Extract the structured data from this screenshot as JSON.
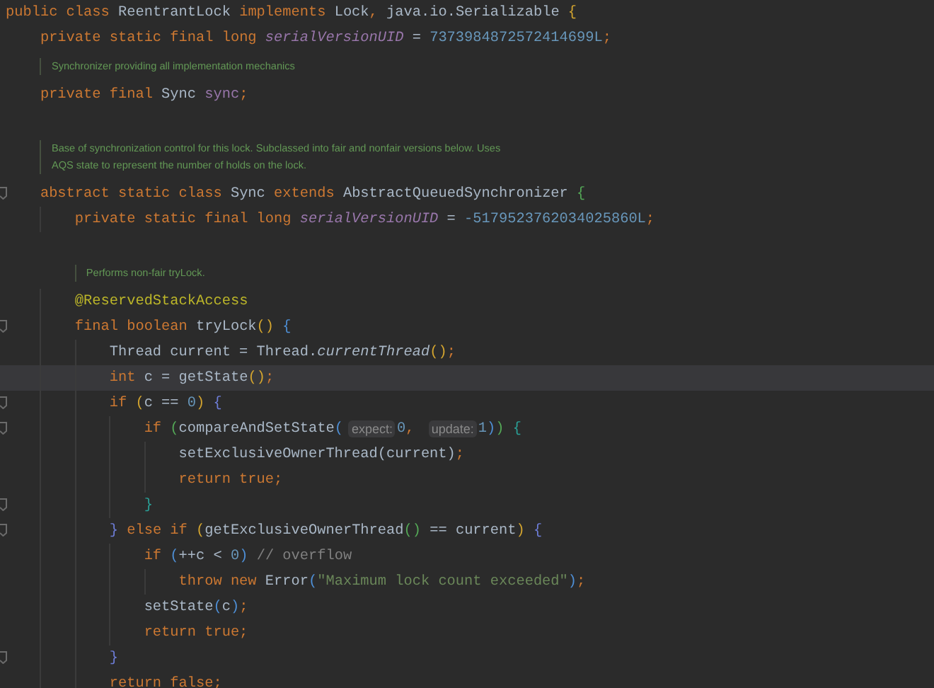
{
  "editor": {
    "lines": [
      {
        "kind": "code",
        "fold": false,
        "current": false,
        "tokens": [
          {
            "text": "public class ",
            "kind": "kw"
          },
          {
            "text": "ReentrantLock ",
            "kind": "plain"
          },
          {
            "text": "implements ",
            "kind": "kw"
          },
          {
            "text": "Lock",
            "kind": "plain"
          },
          {
            "text": ", ",
            "kind": "kw"
          },
          {
            "text": "java.io.Serializable ",
            "kind": "plain"
          },
          {
            "text": "{",
            "kind": "b1"
          }
        ]
      },
      {
        "kind": "code",
        "fold": false,
        "current": false,
        "tokens": [
          {
            "text": "    private static final long ",
            "kind": "kw"
          },
          {
            "text": "serialVersionUID",
            "kind": "sfield"
          },
          {
            "text": " = ",
            "kind": "plain"
          },
          {
            "text": "7373984872572414699L",
            "kind": "num"
          },
          {
            "text": ";",
            "kind": "kw"
          }
        ]
      },
      {
        "kind": "doc",
        "text": [
          "Synchronizer providing all implementation mechanics"
        ]
      },
      {
        "kind": "code",
        "fold": false,
        "current": false,
        "tokens": [
          {
            "text": "    private final ",
            "kind": "kw"
          },
          {
            "text": "Sync ",
            "kind": "plain"
          },
          {
            "text": "sync",
            "kind": "field"
          },
          {
            "text": ";",
            "kind": "kw"
          }
        ]
      },
      {
        "kind": "blank"
      },
      {
        "kind": "doc",
        "text": [
          "Base of synchronization control for this lock. Subclassed into fair and nonfair versions below. Uses",
          "AQS state to represent the number of holds on the lock."
        ]
      },
      {
        "kind": "code",
        "fold": true,
        "current": false,
        "tokens": [
          {
            "text": "    abstract static class ",
            "kind": "kw"
          },
          {
            "text": "Sync ",
            "kind": "plain"
          },
          {
            "text": "extends ",
            "kind": "kw"
          },
          {
            "text": "AbstractQueuedSynchronizer ",
            "kind": "plain"
          },
          {
            "text": "{",
            "kind": "b2"
          }
        ]
      },
      {
        "kind": "code",
        "fold": false,
        "current": false,
        "tokens": [
          {
            "text": "        private static final long ",
            "kind": "kw"
          },
          {
            "text": "serialVersionUID",
            "kind": "sfield"
          },
          {
            "text": " = ",
            "kind": "plain"
          },
          {
            "text": "-5179523762034025860L",
            "kind": "num"
          },
          {
            "text": ";",
            "kind": "kw"
          }
        ]
      },
      {
        "kind": "blank"
      },
      {
        "kind": "doc",
        "text": [
          "Performs non-fair tryLock."
        ]
      },
      {
        "kind": "code",
        "fold": false,
        "current": false,
        "tokens": [
          {
            "text": "        @ReservedStackAccess",
            "kind": "ann"
          }
        ]
      },
      {
        "kind": "code",
        "fold": true,
        "current": false,
        "tokens": [
          {
            "text": "        final boolean ",
            "kind": "kw"
          },
          {
            "text": "tryLock",
            "kind": "plain"
          },
          {
            "text": "() ",
            "kind": "b1"
          },
          {
            "text": "{",
            "kind": "b3"
          }
        ]
      },
      {
        "kind": "code",
        "fold": false,
        "current": false,
        "tokens": [
          {
            "text": "            Thread current = Thread.",
            "kind": "plain"
          },
          {
            "text": "currentThread",
            "kind": "ital"
          },
          {
            "text": "()",
            "kind": "b1"
          },
          {
            "text": ";",
            "kind": "kw"
          }
        ]
      },
      {
        "kind": "code",
        "fold": false,
        "current": true,
        "tokens": [
          {
            "text": "            int ",
            "kind": "kw"
          },
          {
            "text": "c = getState",
            "kind": "plain"
          },
          {
            "text": "()",
            "kind": "b1"
          },
          {
            "text": ";",
            "kind": "kw"
          }
        ]
      },
      {
        "kind": "code",
        "fold": true,
        "current": false,
        "tokens": [
          {
            "text": "            if ",
            "kind": "kw"
          },
          {
            "text": "(",
            "kind": "b1"
          },
          {
            "text": "c == ",
            "kind": "plain"
          },
          {
            "text": "0",
            "kind": "num"
          },
          {
            "text": ") ",
            "kind": "b1"
          },
          {
            "text": "{",
            "kind": "b5"
          }
        ]
      },
      {
        "kind": "code",
        "fold": true,
        "current": false,
        "tokens": [
          {
            "text": "                if ",
            "kind": "kw"
          },
          {
            "text": "(",
            "kind": "b2"
          },
          {
            "text": "compareAndSetState",
            "kind": "plain"
          },
          {
            "text": "(",
            "kind": "b3"
          },
          {
            "text": "expect:",
            "kind": "hint"
          },
          {
            "text": "0",
            "kind": "num"
          },
          {
            "text": ", ",
            "kind": "kw"
          },
          {
            "text": "update:",
            "kind": "hint"
          },
          {
            "text": "1",
            "kind": "num"
          },
          {
            "text": ")",
            "kind": "b3"
          },
          {
            "text": ") ",
            "kind": "b2"
          },
          {
            "text": "{",
            "kind": "b4"
          }
        ]
      },
      {
        "kind": "code",
        "fold": false,
        "current": false,
        "tokens": [
          {
            "text": "                    setExclusiveOwnerThread(current)",
            "kind": "plain"
          },
          {
            "text": ";",
            "kind": "kw"
          }
        ]
      },
      {
        "kind": "code",
        "fold": false,
        "current": false,
        "tokens": [
          {
            "text": "                    return true;",
            "kind": "kw"
          }
        ]
      },
      {
        "kind": "code",
        "fold": true,
        "current": false,
        "tokens": [
          {
            "text": "                }",
            "kind": "b4"
          }
        ]
      },
      {
        "kind": "code",
        "fold": true,
        "current": false,
        "tokens": [
          {
            "text": "            }",
            "kind": "b5"
          },
          {
            "text": " else if ",
            "kind": "kw"
          },
          {
            "text": "(",
            "kind": "b1"
          },
          {
            "text": "getExclusiveOwnerThread",
            "kind": "plain"
          },
          {
            "text": "()",
            "kind": "b2"
          },
          {
            "text": " == current",
            "kind": "plain"
          },
          {
            "text": ") ",
            "kind": "b1"
          },
          {
            "text": "{",
            "kind": "b5"
          }
        ]
      },
      {
        "kind": "code",
        "fold": false,
        "current": false,
        "tokens": [
          {
            "text": "                if ",
            "kind": "kw"
          },
          {
            "text": "(",
            "kind": "b3"
          },
          {
            "text": "++c < ",
            "kind": "plain"
          },
          {
            "text": "0",
            "kind": "num"
          },
          {
            "text": ")",
            "kind": "b3"
          },
          {
            "text": " // overflow",
            "kind": "cmt"
          }
        ]
      },
      {
        "kind": "code",
        "fold": false,
        "current": false,
        "tokens": [
          {
            "text": "                    throw new ",
            "kind": "kw"
          },
          {
            "text": "Error",
            "kind": "plain"
          },
          {
            "text": "(",
            "kind": "b3"
          },
          {
            "text": "\"Maximum lock count exceeded\"",
            "kind": "str"
          },
          {
            "text": ")",
            "kind": "b3"
          },
          {
            "text": ";",
            "kind": "kw"
          }
        ]
      },
      {
        "kind": "code",
        "fold": false,
        "current": false,
        "tokens": [
          {
            "text": "                setState",
            "kind": "plain"
          },
          {
            "text": "(",
            "kind": "b3"
          },
          {
            "text": "c",
            "kind": "plain"
          },
          {
            "text": ")",
            "kind": "b3"
          },
          {
            "text": ";",
            "kind": "kw"
          }
        ]
      },
      {
        "kind": "code",
        "fold": false,
        "current": false,
        "tokens": [
          {
            "text": "                return true;",
            "kind": "kw"
          }
        ]
      },
      {
        "kind": "code",
        "fold": true,
        "current": false,
        "tokens": [
          {
            "text": "            }",
            "kind": "b5"
          }
        ]
      },
      {
        "kind": "code",
        "fold": false,
        "current": false,
        "tokens": [
          {
            "text": "            return false;",
            "kind": "kw"
          }
        ]
      }
    ]
  }
}
